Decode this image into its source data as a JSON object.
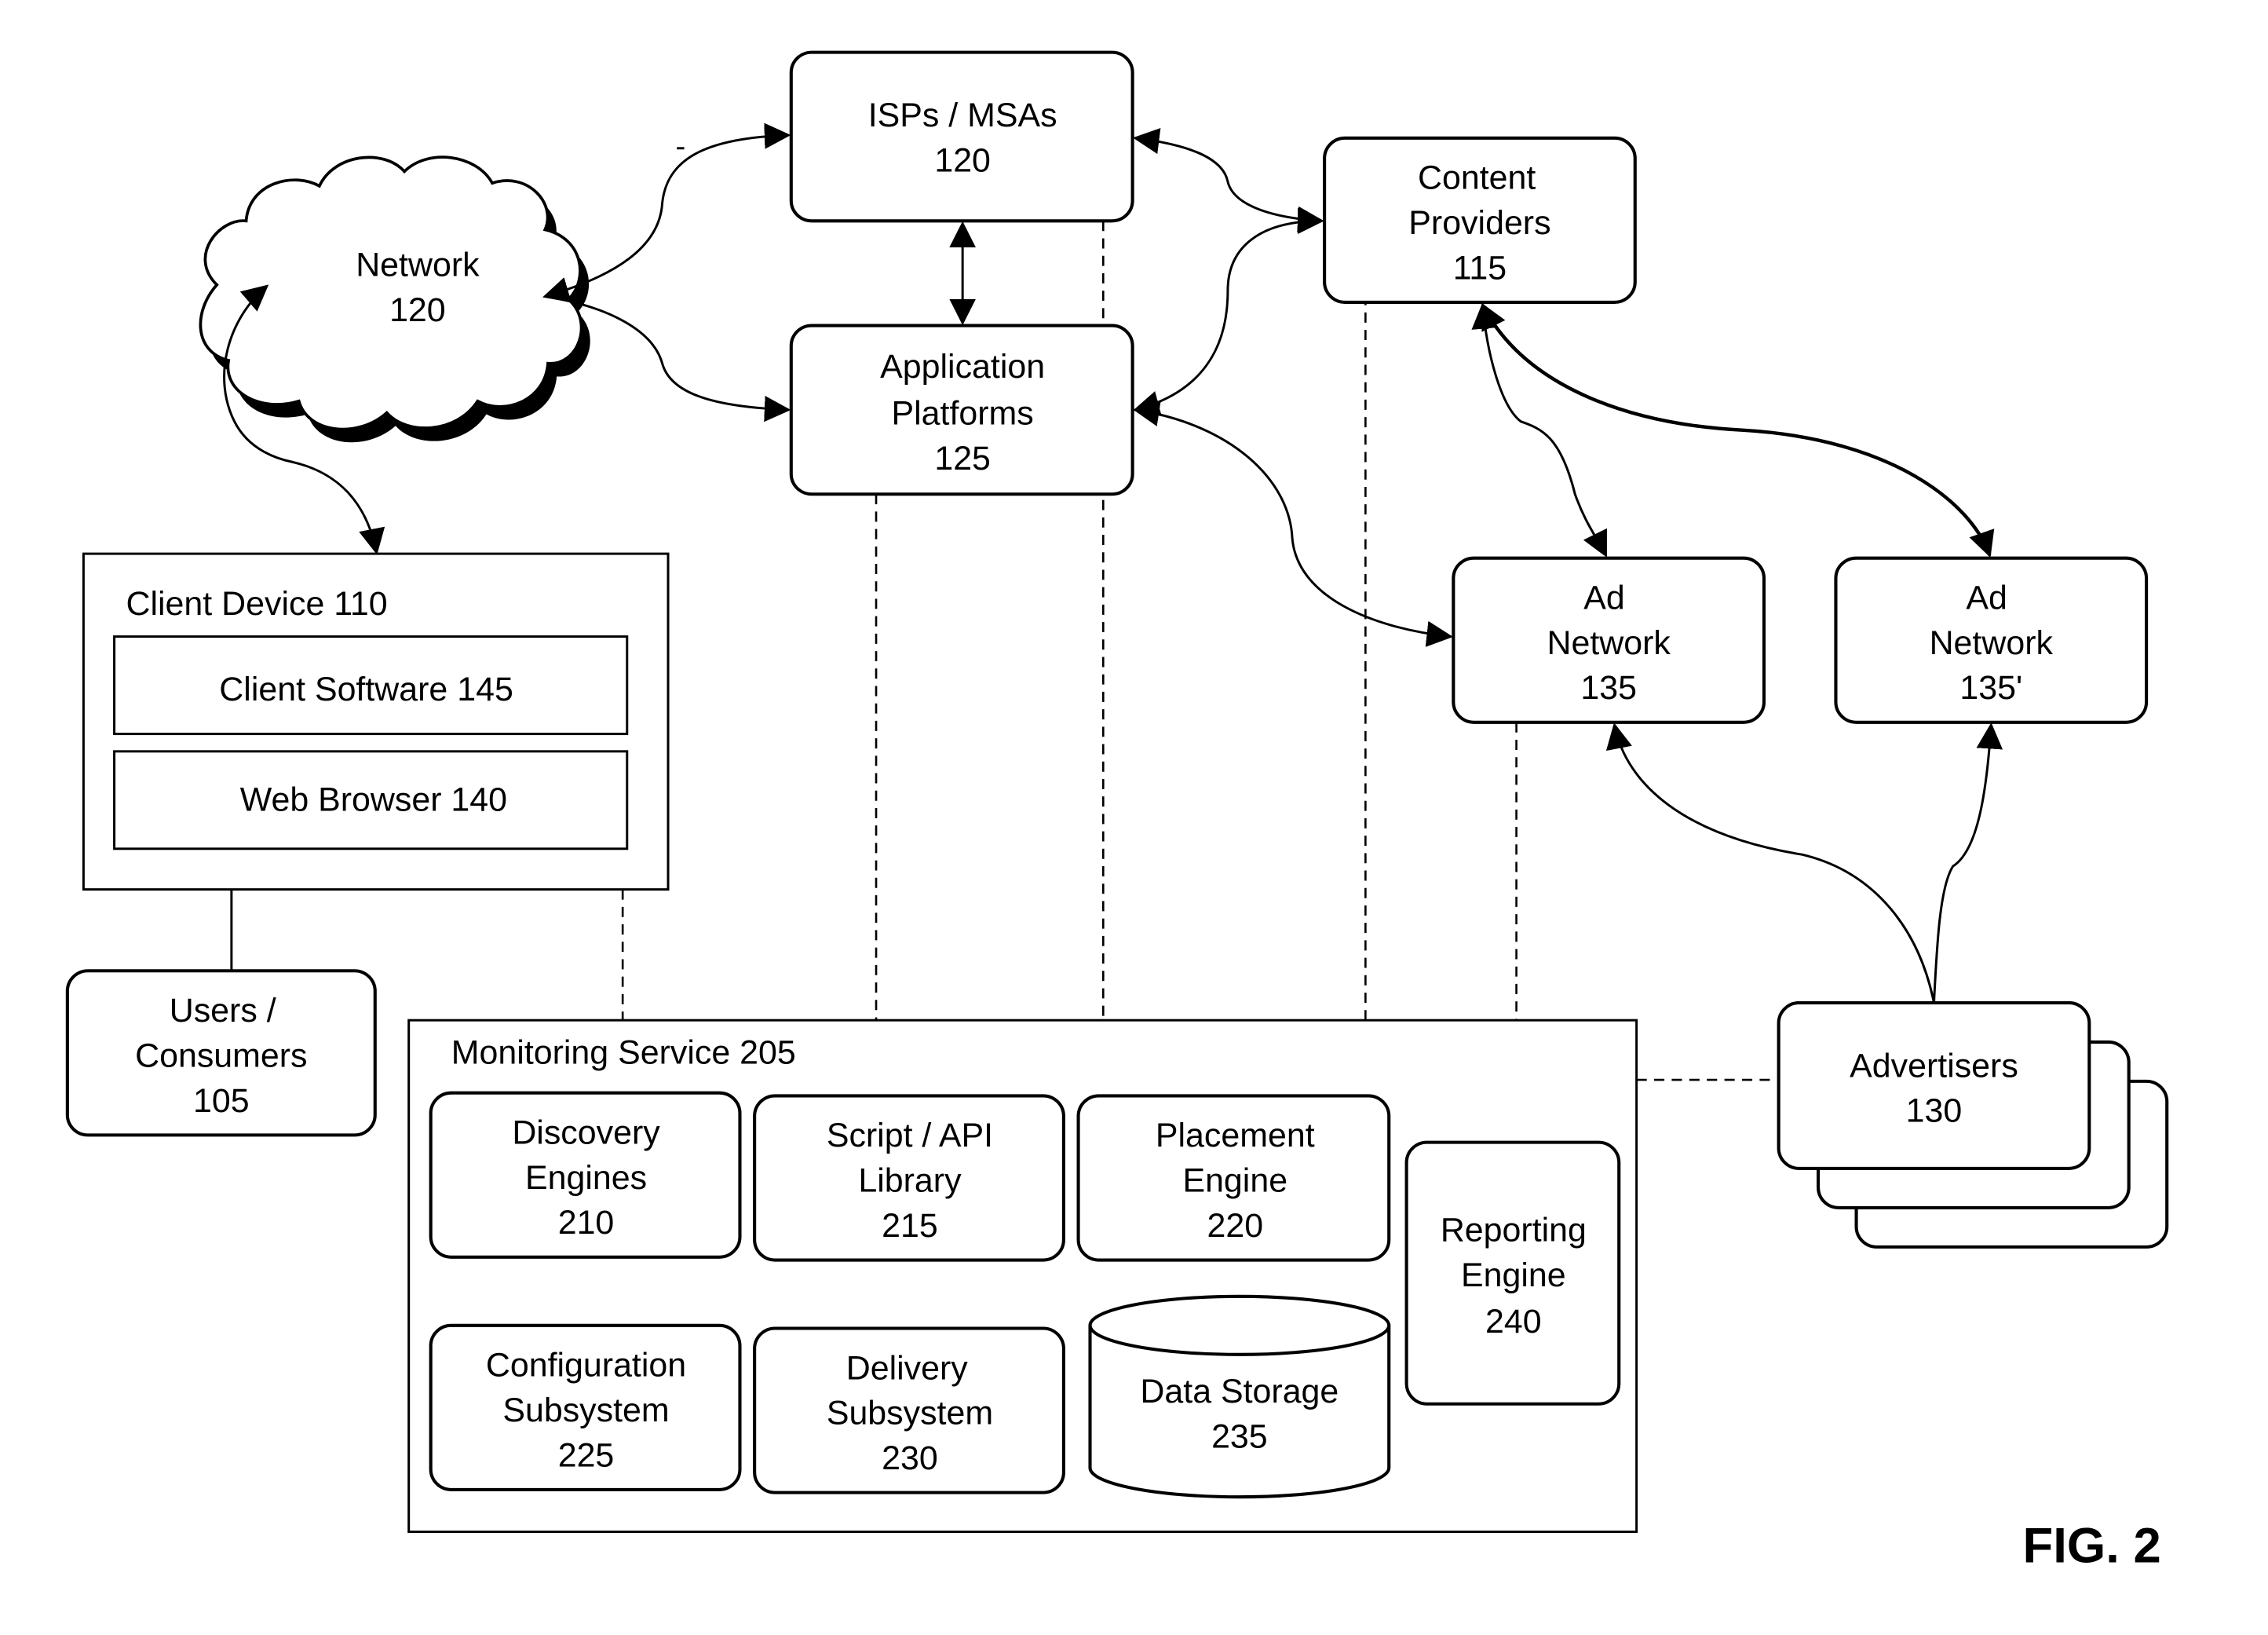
{
  "figure_label": "FIG. 2",
  "nodes": {
    "network": {
      "lines": [
        "Network",
        "120"
      ],
      "shape": "cloud"
    },
    "isps": {
      "lines": [
        "ISPs / MSAs",
        "120"
      ]
    },
    "content_providers": {
      "lines": [
        "Content",
        "Providers",
        "115"
      ]
    },
    "application_platforms": {
      "lines": [
        "Application",
        "Platforms",
        "125"
      ]
    },
    "ad_network_1": {
      "lines": [
        "Ad",
        "Network",
        "135"
      ]
    },
    "ad_network_2": {
      "lines": [
        "Ad",
        "Network",
        "135'"
      ]
    },
    "client_device": {
      "title": "Client Device 110",
      "children": [
        "Client Software 145",
        "Web Browser 140"
      ]
    },
    "users": {
      "lines": [
        "Users /",
        "Consumers",
        "105"
      ]
    },
    "monitoring_service": {
      "title": "Monitoring Service 205",
      "components": {
        "discovery": {
          "lines": [
            "Discovery",
            "Engines",
            "210"
          ]
        },
        "script_api": {
          "lines": [
            "Script / API",
            "Library",
            "215"
          ]
        },
        "placement": {
          "lines": [
            "Placement",
            "Engine",
            "220"
          ]
        },
        "reporting": {
          "lines": [
            "Reporting",
            "Engine",
            "240"
          ]
        },
        "configuration": {
          "lines": [
            "Configuration",
            "Subsystem",
            "225"
          ]
        },
        "delivery": {
          "lines": [
            "Delivery",
            "Subsystem",
            "230"
          ]
        },
        "data_storage": {
          "lines": [
            "Data Storage",
            "235"
          ],
          "shape": "cylinder"
        }
      }
    },
    "advertisers": {
      "lines": [
        "Advertisers",
        "130"
      ],
      "stacked": 3
    }
  },
  "connections": [
    {
      "from": "network",
      "to": "isps",
      "type": "bidirectional"
    },
    {
      "from": "network",
      "to": "application_platforms",
      "type": "bidirectional"
    },
    {
      "from": "network",
      "to": "client_device",
      "type": "bidirectional"
    },
    {
      "from": "isps",
      "to": "application_platforms",
      "type": "bidirectional"
    },
    {
      "from": "isps",
      "to": "content_providers",
      "type": "bidirectional"
    },
    {
      "from": "application_platforms",
      "to": "content_providers",
      "type": "bidirectional"
    },
    {
      "from": "application_platforms",
      "to": "ad_network_1",
      "type": "bidirectional"
    },
    {
      "from": "content_providers",
      "to": "ad_network_1",
      "type": "bidirectional"
    },
    {
      "from": "content_providers",
      "to": "ad_network_2",
      "type": "bidirectional"
    },
    {
      "from": "advertisers",
      "to": "ad_network_1",
      "type": "directed"
    },
    {
      "from": "advertisers",
      "to": "ad_network_2",
      "type": "directed"
    },
    {
      "from": "client_device",
      "to": "users",
      "type": "line"
    },
    {
      "from": "client_device",
      "to": "monitoring_service",
      "type": "dashed"
    },
    {
      "from": "application_platforms",
      "to": "monitoring_service",
      "type": "dashed"
    },
    {
      "from": "isps",
      "to": "monitoring_service",
      "type": "dashed"
    },
    {
      "from": "content_providers",
      "to": "monitoring_service",
      "type": "dashed"
    },
    {
      "from": "ad_network_1",
      "to": "monitoring_service",
      "type": "dashed"
    },
    {
      "from": "advertisers",
      "to": "monitoring_service",
      "type": "dashed"
    }
  ]
}
